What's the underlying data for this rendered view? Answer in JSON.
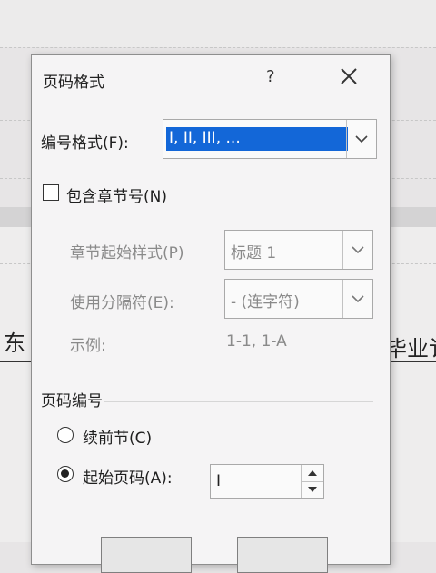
{
  "document": {
    "left_text": "东",
    "right_text": "毕业讠"
  },
  "dialog": {
    "title": "页码格式",
    "help_label": "?",
    "number_format": {
      "label": "编号格式(F):",
      "value": "I, II, III, ..."
    },
    "include_chapter": {
      "label": "包含章节号(N)",
      "checked": false
    },
    "chapter_style": {
      "label": "章节起始样式(P)",
      "value": "标题 1"
    },
    "separator": {
      "label": "使用分隔符(E):",
      "value": "-   (连字符)"
    },
    "example": {
      "label": "示例:",
      "value": "1-1, 1-A"
    },
    "page_numbering": {
      "section_label": "页码编号",
      "continue_label": "续前节(C)",
      "start_at_label": "起始页码(A):",
      "start_at_value": "I",
      "selected": "start_at"
    }
  },
  "colors": {
    "selection": "#1367d8",
    "disabled_text": "#8a8a8a"
  }
}
